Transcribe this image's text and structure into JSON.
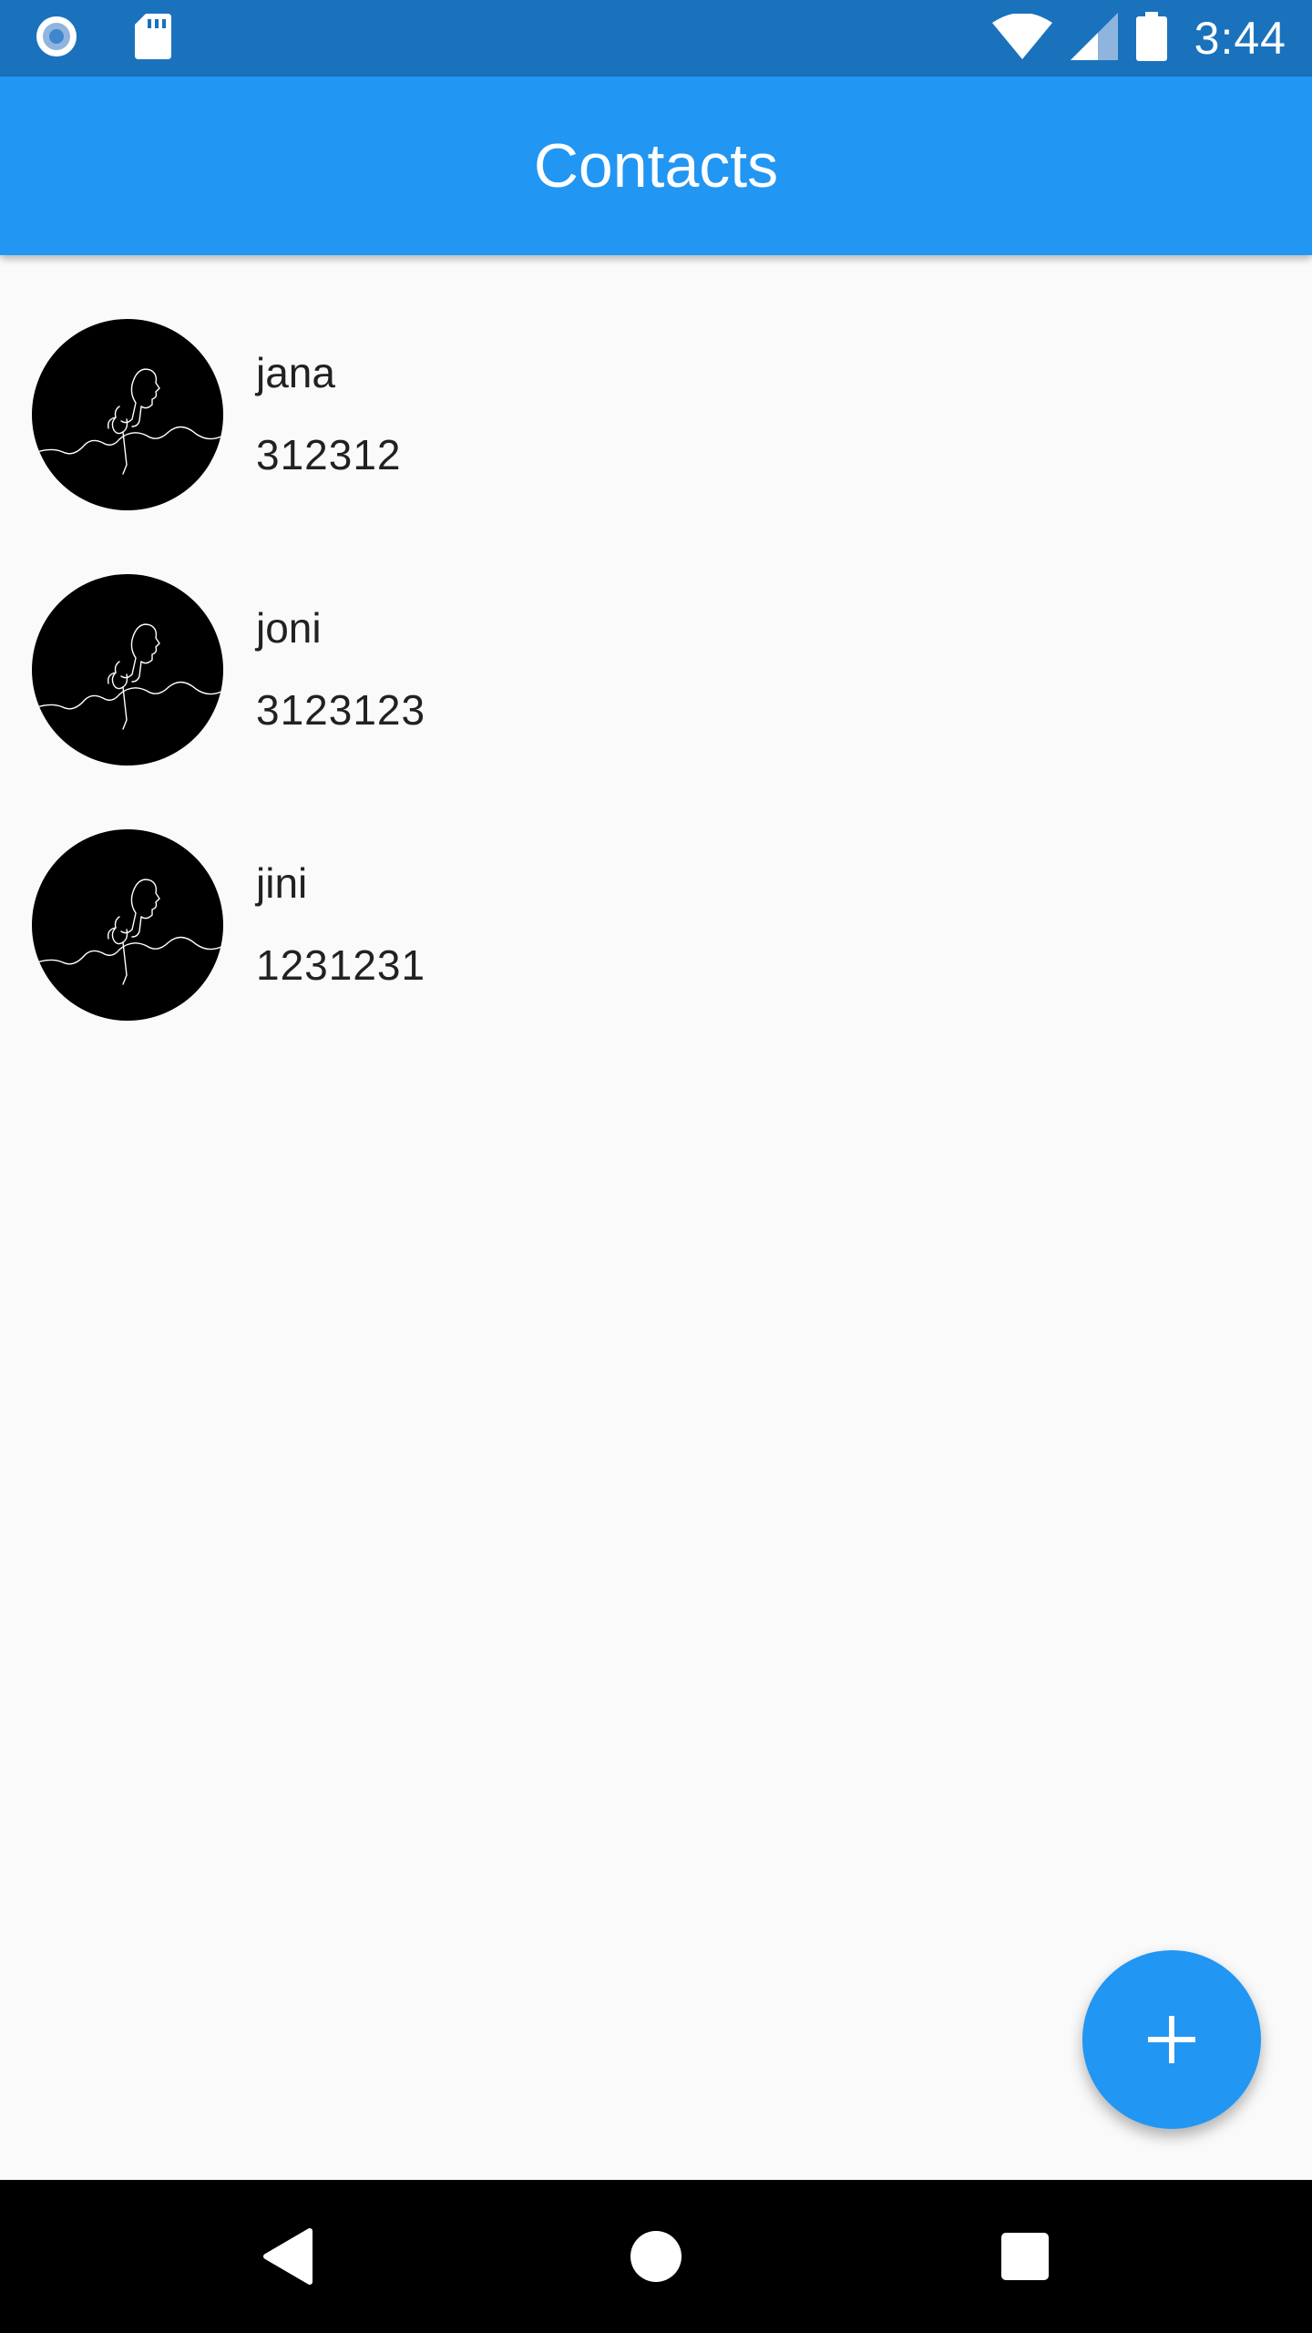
{
  "status_bar": {
    "time": "3:44",
    "left_icons": [
      "record-icon",
      "sd-card-icon"
    ],
    "right_icons": [
      "wifi-icon",
      "signal-icon",
      "battery-icon"
    ]
  },
  "app_bar": {
    "title": "Contacts"
  },
  "contacts": [
    {
      "name": "jana",
      "phone": "312312",
      "avatar_icon": "avatar-line-art-portrait"
    },
    {
      "name": "joni",
      "phone": "3123123",
      "avatar_icon": "avatar-line-art-portrait"
    },
    {
      "name": "jini",
      "phone": "1231231",
      "avatar_icon": "avatar-line-art-portrait"
    }
  ],
  "fab": {
    "icon": "plus-icon"
  },
  "nav_bar": {
    "icons": [
      "back-icon",
      "home-icon",
      "recents-icon"
    ]
  },
  "colors": {
    "status_bar": "#1a72bd",
    "app_bar": "#2196f3",
    "background": "#fafafa",
    "fab": "#2196f3",
    "text": "#212121",
    "nav_bar": "#000000"
  }
}
